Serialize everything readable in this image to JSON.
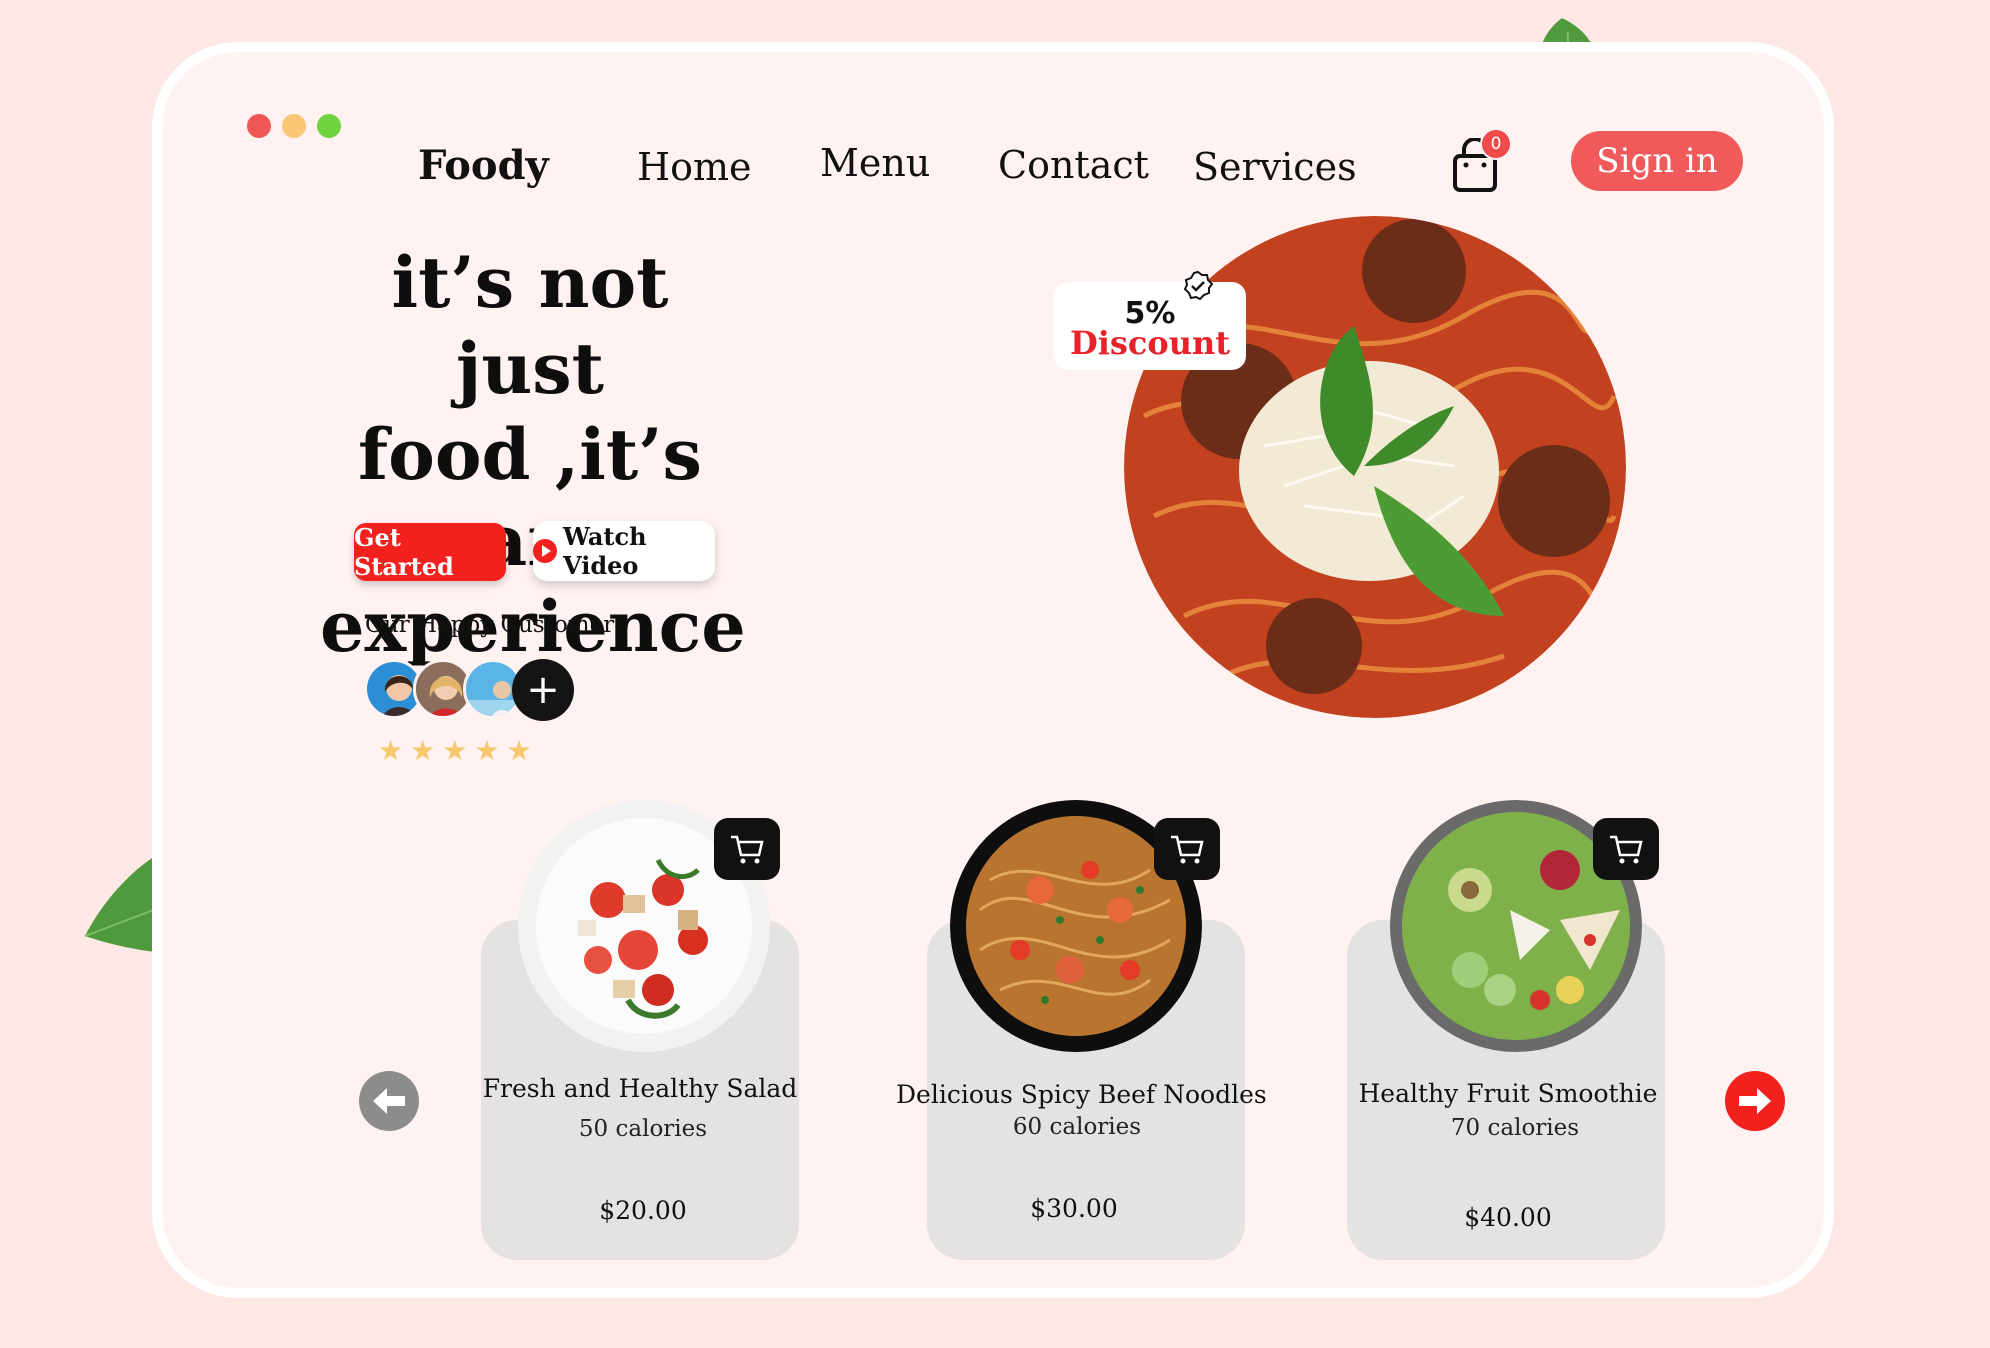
{
  "window_controls": {
    "colors": [
      "#f05656",
      "#f9c775",
      "#6fd33f"
    ]
  },
  "nav": {
    "brand": "Foody",
    "items": [
      "Home",
      "Menu",
      "Contact",
      "Services"
    ],
    "cart_count": "0",
    "cart_icon": "shopping-bag-icon",
    "signin_label": "Sign in"
  },
  "hero": {
    "title_lines": [
      "it’s not just",
      "food ,it’s an",
      "experience"
    ],
    "get_started_label": "Get Started",
    "watch_video_label": "Watch Video",
    "customers_label": "Our Happy Customer",
    "rating_stars": 5,
    "discount_percent": "5%",
    "discount_label": "Discount"
  },
  "products": [
    {
      "name": "Fresh and Healthy Salad",
      "calories": "50 calories",
      "price": "$20.00"
    },
    {
      "name": "Delicious Spicy Beef Noodles",
      "calories": "60 calories",
      "price": "$30.00"
    },
    {
      "name": "Healthy Fruit Smoothie",
      "calories": "70 calories",
      "price": "$40.00"
    }
  ],
  "colors": {
    "accent": "#f2211e",
    "signin": "#f15a5a",
    "background": "#fde8e6",
    "card": "#e4e2e2"
  }
}
